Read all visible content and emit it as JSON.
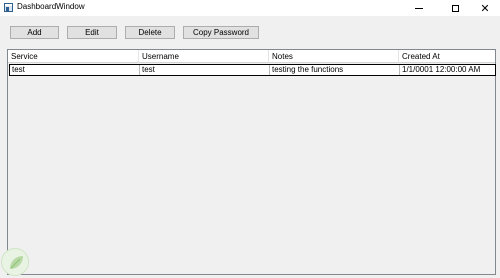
{
  "window": {
    "title": "DashboardWindow"
  },
  "toolbar": {
    "add_label": "Add",
    "edit_label": "Edit",
    "delete_label": "Delete",
    "copy_password_label": "Copy Password"
  },
  "table": {
    "columns": [
      "Service",
      "Username",
      "Notes",
      "Created At"
    ],
    "rows": [
      [
        "test",
        "test",
        "testing the functions",
        "1/1/0001 12:00:00 AM"
      ]
    ]
  },
  "icons": {
    "app": "window-app-icon",
    "minimize": "minimize-icon",
    "maximize": "maximize-icon",
    "close": "close-icon",
    "watermark": "leaf-watermark-icon"
  },
  "colors": {
    "window_bg": "#f0f0f0",
    "button_bg": "#e1e1e1",
    "button_border": "#adadad",
    "grid_border": "#828790",
    "selected_row_border": "#000000"
  }
}
